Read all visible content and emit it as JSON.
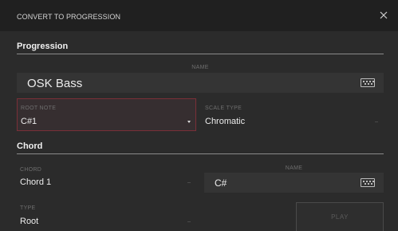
{
  "dialog": {
    "title": "CONVERT TO PROGRESSION"
  },
  "progression": {
    "heading": "Progression",
    "name_label": "NAME",
    "name_value": "OSK Bass",
    "root_note_label": "ROOT NOTE",
    "root_note_value": "C#1",
    "scale_type_label": "SCALE TYPE",
    "scale_type_value": "Chromatic"
  },
  "chord": {
    "heading": "Chord",
    "chord_label": "CHORD",
    "chord_value": "Chord 1",
    "name_label": "NAME",
    "name_value": "C#",
    "type_label": "TYPE",
    "type_value": "Root",
    "play_label": "PLAY"
  },
  "icons": {
    "close": "close-icon",
    "keyboard": "keyboard-icon",
    "dropdown": "chevron-down-icon"
  },
  "colors": {
    "accent_border": "#7a2f38",
    "background": "#2b2b2b",
    "titlebar": "#202020"
  }
}
